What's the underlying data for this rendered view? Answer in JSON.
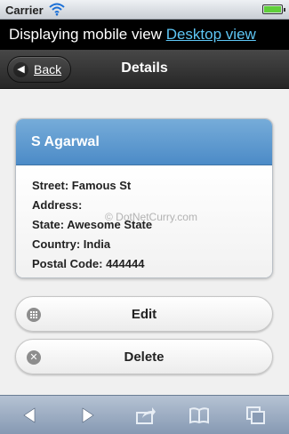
{
  "status_bar": {
    "carrier": "Carrier"
  },
  "banner": {
    "text": "Displaying mobile view",
    "link": "Desktop view"
  },
  "header": {
    "back_label": "Back",
    "title": "Details"
  },
  "card": {
    "name": "S Agarwal",
    "rows": [
      "Street: Famous St",
      "Address:",
      "State: Awesome State",
      "Country: India",
      "Postal Code: 444444"
    ]
  },
  "watermark": "© DotNetCurry.com",
  "actions": {
    "edit_label": "Edit",
    "delete_label": "Delete"
  },
  "icons": {
    "wifi": "wifi-icon",
    "battery": "battery-icon",
    "back": "left-arrow-icon",
    "edit": "grid-icon",
    "delete": "close-icon",
    "toolbar": [
      "back-arrow-icon",
      "forward-arrow-icon",
      "share-icon",
      "bookmarks-icon",
      "tabs-icon"
    ]
  },
  "colors": {
    "card_header": "#5a97cf",
    "link": "#5ec6f5",
    "battery": "#5fcf3a"
  }
}
